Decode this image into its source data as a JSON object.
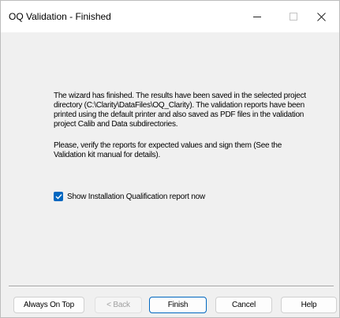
{
  "window": {
    "title": "OQ Validation - Finished"
  },
  "message": {
    "paragraph1": "The wizard has finished. The results have been saved in the selected project directory (C:\\Clarity\\DataFiles\\OQ_Clarity). The validation reports have been printed using the default printer and also saved as PDF files in the validation project Calib and Data subdirectories.",
    "paragraph2": "Please, verify the reports for expected values and sign them (See the Validation kit manual for details)."
  },
  "option": {
    "label": "Show Installation Qualification report now",
    "checked": true
  },
  "buttons": {
    "always_on_top": "Always On Top",
    "back": "< Back",
    "finish": "Finish",
    "cancel": "Cancel",
    "help": "Help"
  },
  "colors": {
    "accent": "#0067c0",
    "background": "#f0f0f0",
    "titlebar": "#ffffff"
  }
}
